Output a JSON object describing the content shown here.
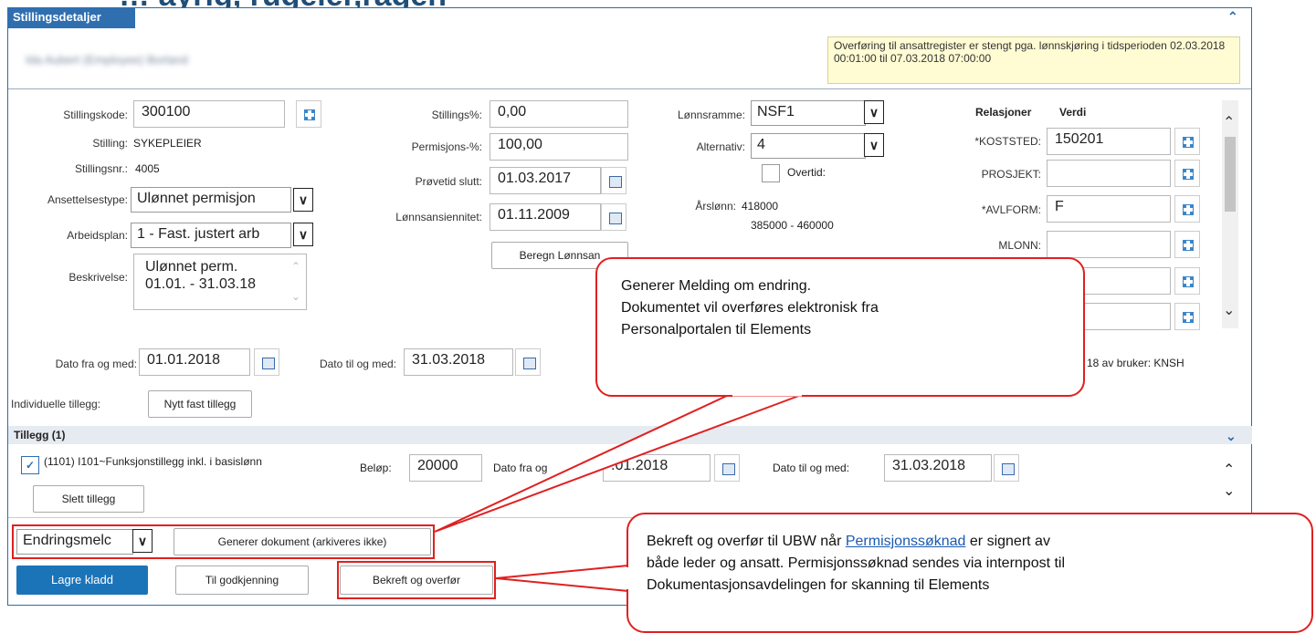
{
  "window": {
    "title": "Stillingsdetaljer",
    "notice": "Overføring til ansattregister er stengt pga. lønnskjøring i tidsperioden 02.03.2018 00:01:00 til 07.03.2018 07:00:00",
    "person_name_blurred": "Ida Aubert (Employee) Borland"
  },
  "left": {
    "stillingskode_label": "Stillingskode:",
    "stillingskode_value": "300100",
    "stilling_label": "Stilling:",
    "stilling_value": "SYKEPLEIER",
    "stillingsnr_label": "Stillingsnr.:",
    "stillingsnr_value": "4005",
    "ansettelsestype_label": "Ansettelsestype:",
    "ansettelsestype_value": "Ulønnet permisjon",
    "arbeidsplan_label": "Arbeidsplan:",
    "arbeidsplan_value": "1 - Fast. justert arb",
    "beskrivelse_label": "Beskrivelse:",
    "beskrivelse_line1": "Ulønnet perm.",
    "beskrivelse_line2": "01.01. - 31.03.18"
  },
  "middle": {
    "stillingsprosent_label": "Stillings%:",
    "stillingsprosent_value": "0,00",
    "permisjon_label": "Permisjons-%:",
    "permisjon_value": "100,00",
    "provetid_label": "Prøvetid slutt:",
    "provetid_value": "01.03.2017",
    "lonnsansiennitet_label": "Lønnsansiennitet:",
    "lonnsansiennitet_value": "01.11.2009",
    "beregn_label": "Beregn Lønnsan"
  },
  "salary": {
    "lonnsramme_label": "Lønnsramme:",
    "lonnsramme_value": "NSF1",
    "alternativ_label": "Alternativ:",
    "alternativ_value": "4",
    "overtid_label": "Overtid:",
    "arslonn_label": "Årslønn:",
    "arslonn_value": "418000",
    "arslonn_range": "385000 - 460000"
  },
  "relations": {
    "header_rel": "Relasjoner",
    "header_val": "Verdi",
    "items": [
      {
        "label": "*KOSTSTED:",
        "value": "150201"
      },
      {
        "label": "PROSJEKT:",
        "value": ""
      },
      {
        "label": "*AVLFORM:",
        "value": "F"
      },
      {
        "label": "MLONN:",
        "value": ""
      }
    ]
  },
  "dates": {
    "fra_label": "Dato fra og med:",
    "fra_value": "01.01.2018",
    "til_label": "Dato til og med:",
    "til_value": "31.03.2018",
    "audit": "18 av bruker: KNSH"
  },
  "tillegg": {
    "individuelle_label": "Individuelle tillegg:",
    "new_button": "Nytt fast tillegg",
    "section_title": "Tillegg (1)",
    "item_label": "(1101) I101~Funksjonstillegg inkl. i basislønn",
    "belop_label": "Beløp:",
    "belop_value": "20000",
    "fra_label": "Dato fra og",
    "fra_value": ".01.2018",
    "til_label": "Dato til og med:",
    "til_value": "31.03.2018",
    "delete_button": "Slett tillegg"
  },
  "footer": {
    "doc_type": "Endringsmelc",
    "generate_button": "Generer dokument (arkiveres ikke)",
    "save_button": "Lagre kladd",
    "approve_button": "Til godkjenning",
    "confirm_button": "Bekreft og overfør"
  },
  "callouts": {
    "top_line1": "Generer Melding om endring.",
    "top_line2": "Dokumentet vil overføres elektronisk fra",
    "top_line3": "Personalportalen til Elements",
    "bottom_pre": "Bekreft og overfør til UBW når ",
    "bottom_link": "Permisjonssøknad",
    "bottom_post": " er signert av",
    "bottom_line2": "både leder og ansatt. Permisjonssøknad sendes via internpost til",
    "bottom_line3": "Dokumentasjonsavdelingen for skanning til Elements"
  },
  "colors": {
    "brand": "#2f6fb0",
    "primary_button": "#1c74b8",
    "callout_border": "#e02020",
    "notice_bg": "#fffbd3"
  }
}
